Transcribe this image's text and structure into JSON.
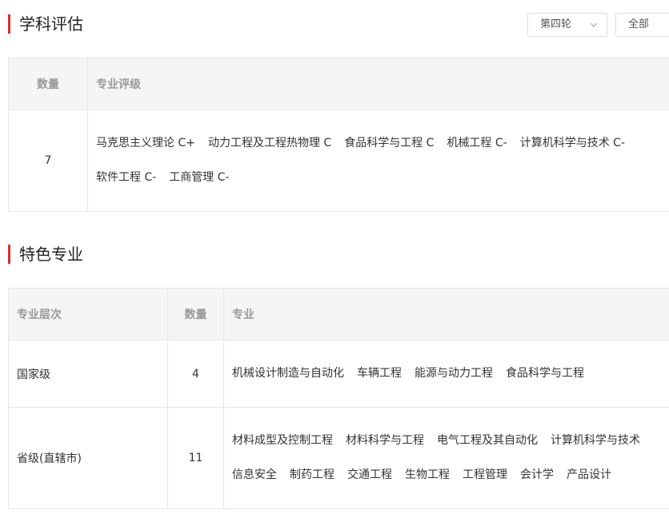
{
  "eval_section": {
    "title": "学科评估",
    "round_select": {
      "value": "第四轮"
    },
    "scope_select": {
      "value": "全部"
    },
    "table": {
      "headers": [
        "数量",
        "专业评级"
      ],
      "count": "7",
      "ratings": [
        "马克思主义理论 C+",
        "动力工程及工程热物理 C",
        "食品科学与工程 C",
        "机械工程 C-",
        "计算机科学与技术 C-",
        "软件工程 C-",
        "工商管理 C-"
      ]
    }
  },
  "feature_section": {
    "title": "特色专业",
    "table": {
      "headers": [
        "专业层次",
        "数量",
        "专业"
      ],
      "rows": [
        {
          "level": "国家级",
          "count": "4",
          "majors": [
            "机械设计制造与自动化",
            "车辆工程",
            "能源与动力工程",
            "食品科学与工程"
          ]
        },
        {
          "level": "省级(直辖市)",
          "count": "11",
          "majors": [
            "材料成型及控制工程",
            "材料科学与工程",
            "电气工程及其自动化",
            "计算机科学与技术",
            "信息安全",
            "制药工程",
            "交通工程",
            "生物工程",
            "工程管理",
            "会计学",
            "产品设计"
          ]
        }
      ]
    }
  }
}
